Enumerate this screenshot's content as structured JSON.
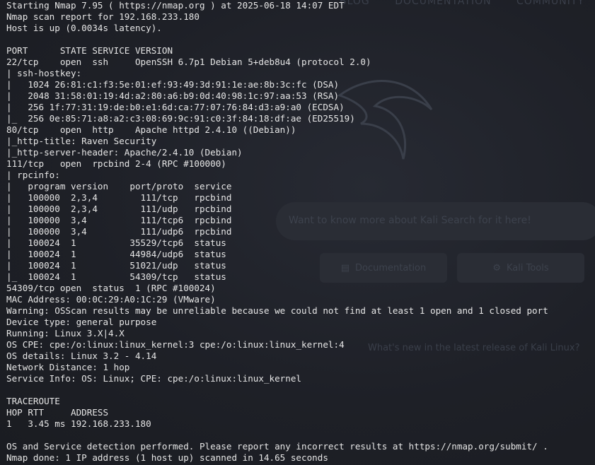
{
  "background": {
    "nav_items": [
      "BLOG",
      "DOCUMENTATION",
      "COMMUNITY"
    ],
    "search_placeholder": "Want to know more about Kali Search for it here!",
    "buttons": {
      "documentation": "Documentation",
      "kali_tools": "Kali Tools"
    },
    "news_text": "What's new in the latest release of Kali Linux?"
  },
  "terminal": {
    "lines": [
      "Starting Nmap 7.95 ( https://nmap.org ) at 2025-06-18 14:07 EDT",
      "Nmap scan report for 192.168.233.180",
      "Host is up (0.0034s latency).",
      "",
      "PORT      STATE SERVICE VERSION",
      "22/tcp    open  ssh     OpenSSH 6.7p1 Debian 5+deb8u4 (protocol 2.0)",
      "| ssh-hostkey:",
      "|   1024 26:81:c1:f3:5e:01:ef:93:49:3d:91:1e:ae:8b:3c:fc (DSA)",
      "|   2048 31:58:01:19:4d:a2:80:a6:b9:0d:40:98:1c:97:aa:53 (RSA)",
      "|   256 1f:77:31:19:de:b0:e1:6d:ca:77:07:76:84:d3:a9:a0 (ECDSA)",
      "|_  256 0e:85:71:a8:a2:c3:08:69:9c:91:c0:3f:84:18:df:ae (ED25519)",
      "80/tcp    open  http    Apache httpd 2.4.10 ((Debian))",
      "|_http-title: Raven Security",
      "|_http-server-header: Apache/2.4.10 (Debian)",
      "111/tcp   open  rpcbind 2-4 (RPC #100000)",
      "| rpcinfo:",
      "|   program version    port/proto  service",
      "|   100000  2,3,4        111/tcp   rpcbind",
      "|   100000  2,3,4        111/udp   rpcbind",
      "|   100000  3,4          111/tcp6  rpcbind",
      "|   100000  3,4          111/udp6  rpcbind",
      "|   100024  1          35529/tcp6  status",
      "|   100024  1          44984/udp6  status",
      "|   100024  1          51021/udp   status",
      "|_  100024  1          54309/tcp   status",
      "54309/tcp open  status  1 (RPC #100024)",
      "MAC Address: 00:0C:29:A0:1C:29 (VMware)",
      "Warning: OSScan results may be unreliable because we could not find at least 1 open and 1 closed port",
      "Device type: general purpose",
      "Running: Linux 3.X|4.X",
      "OS CPE: cpe:/o:linux:linux_kernel:3 cpe:/o:linux:linux_kernel:4",
      "OS details: Linux 3.2 - 4.14",
      "Network Distance: 1 hop",
      "Service Info: OS: Linux; CPE: cpe:/o:linux:linux_kernel",
      "",
      "TRACEROUTE",
      "HOP RTT     ADDRESS",
      "1   3.45 ms 192.168.233.180",
      "",
      "OS and Service detection performed. Please report any incorrect results at https://nmap.org/submit/ .",
      "Nmap done: 1 IP address (1 host up) scanned in 14.65 seconds"
    ]
  }
}
